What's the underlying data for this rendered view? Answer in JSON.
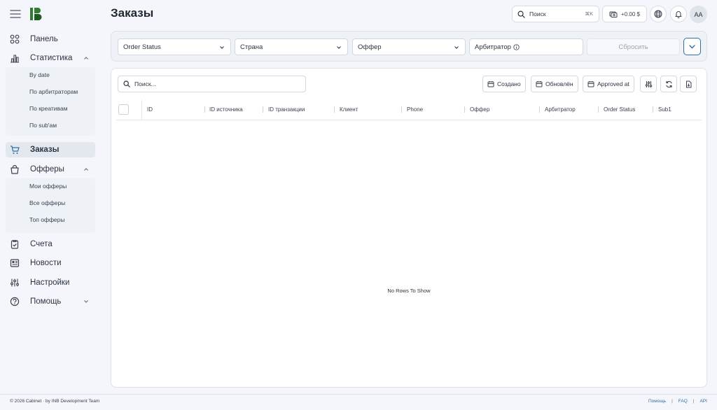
{
  "header": {
    "title": "Заказы",
    "search_label": "Поиск",
    "search_shortcut": "⌘K",
    "balance": "+0.00 $",
    "avatar_initials": "AA"
  },
  "sidebar": {
    "items": [
      {
        "label": "Панель",
        "icon": "grid-icon"
      },
      {
        "label": "Статистика",
        "icon": "chart-icon"
      },
      {
        "label": "Заказы",
        "icon": "cart-icon"
      },
      {
        "label": "Офферы",
        "icon": "bag-icon"
      },
      {
        "label": "Счета",
        "icon": "clipboard-check-icon"
      },
      {
        "label": "Новости",
        "icon": "newspaper-icon"
      },
      {
        "label": "Настройки",
        "icon": "sliders-icon"
      },
      {
        "label": "Помощь",
        "icon": "help-circle-icon"
      }
    ],
    "stats_sub": [
      "By date",
      "По арбитраторам",
      "По креативам",
      "По sub'ам"
    ],
    "offers_sub": [
      "Мои офферы",
      "Все офферы",
      "Топ офферы"
    ]
  },
  "filters": {
    "order_status": "Order Status",
    "country": "Страна",
    "offer": "Оффер",
    "arbitrator": "Арбитратор",
    "reset": "Сбросить"
  },
  "table": {
    "search_placeholder": "Поиск...",
    "created": "Создано",
    "updated": "Обновлён",
    "approved_at": "Approved at",
    "columns": [
      "ID",
      "ID источника",
      "ID транзакции",
      "Клиент",
      "Phone",
      "Оффер",
      "Арбитратор",
      "Order Status",
      "Sub1"
    ],
    "empty_text": "No Rows To Show"
  },
  "footer": {
    "copyright": "© 2026 Cabinet · by INB Development Team",
    "links": [
      "Помощь",
      "FAQ",
      "API"
    ]
  },
  "colors": {
    "accent": "#2f6fa3",
    "logo_green": "#2e7d32",
    "background": "#f4f6fb"
  }
}
